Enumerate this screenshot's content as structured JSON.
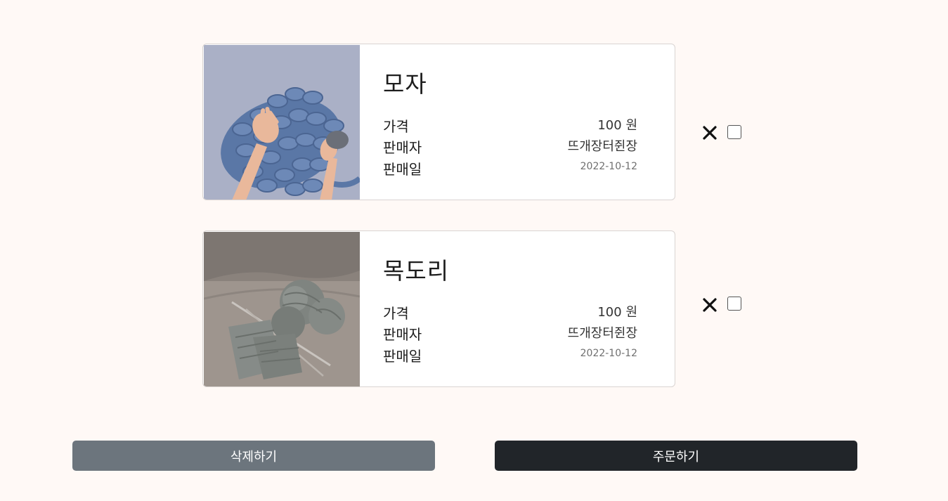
{
  "cart": {
    "items": [
      {
        "name": "모자",
        "price_label": "가격",
        "price": "100 원",
        "seller_label": "판매자",
        "seller": "뜨개장터쥔장",
        "date_label": "판매일",
        "date": "2022-10-12",
        "image_icon": "knit-blanket-photo"
      },
      {
        "name": "목도리",
        "price_label": "가격",
        "price": "100 원",
        "seller_label": "판매자",
        "seller": "뜨개장터쥔장",
        "date_label": "판매일",
        "date": "2022-10-12",
        "image_icon": "yarn-balls-photo"
      }
    ]
  },
  "actions": {
    "delete_label": "삭제하기",
    "order_label": "주문하기"
  },
  "colors": {
    "background": "#fff9f6",
    "delete_button": "#6c757d",
    "order_button": "#212529"
  }
}
